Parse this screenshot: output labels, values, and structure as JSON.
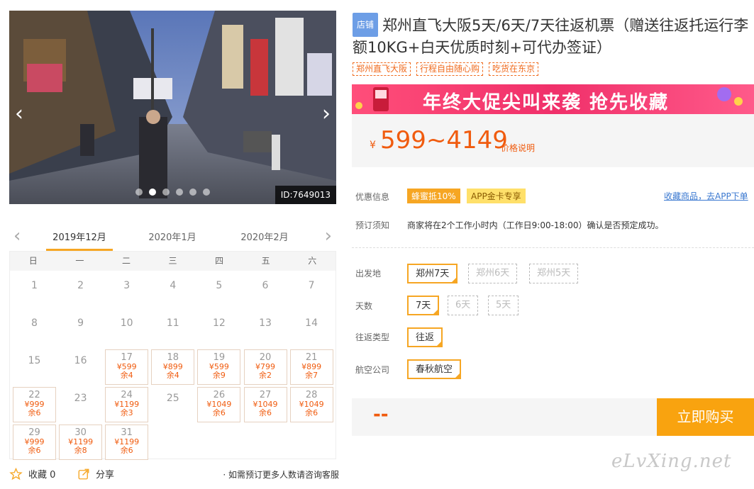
{
  "gallery": {
    "id_label": "ID:7649013",
    "dot_count": 6,
    "active_dot": 1
  },
  "calendar": {
    "months": [
      "2019年12月",
      "2020年1月",
      "2020年2月"
    ],
    "active_month": 0,
    "weekdays": [
      "日",
      "一",
      "二",
      "三",
      "四",
      "五",
      "六"
    ],
    "start_weekday": 0,
    "days": [
      {
        "d": "1"
      },
      {
        "d": "2"
      },
      {
        "d": "3"
      },
      {
        "d": "4"
      },
      {
        "d": "5"
      },
      {
        "d": "6"
      },
      {
        "d": "7"
      },
      {
        "d": "8"
      },
      {
        "d": "9"
      },
      {
        "d": "10"
      },
      {
        "d": "11"
      },
      {
        "d": "12"
      },
      {
        "d": "13"
      },
      {
        "d": "14"
      },
      {
        "d": "15"
      },
      {
        "d": "16"
      },
      {
        "d": "17",
        "p": "¥599",
        "s": "余4"
      },
      {
        "d": "18",
        "p": "¥899",
        "s": "余4"
      },
      {
        "d": "19",
        "p": "¥599",
        "s": "余9"
      },
      {
        "d": "20",
        "p": "¥799",
        "s": "余2"
      },
      {
        "d": "21",
        "p": "¥899",
        "s": "余7"
      },
      {
        "d": "22",
        "p": "¥999",
        "s": "余6"
      },
      {
        "d": "23"
      },
      {
        "d": "24",
        "p": "¥1199",
        "s": "余3"
      },
      {
        "d": "25"
      },
      {
        "d": "26",
        "p": "¥1049",
        "s": "余6"
      },
      {
        "d": "27",
        "p": "¥1049",
        "s": "余6"
      },
      {
        "d": "28",
        "p": "¥1049",
        "s": "余6"
      },
      {
        "d": "29",
        "p": "¥999",
        "s": "余6"
      },
      {
        "d": "30",
        "p": "¥1199",
        "s": "余8"
      },
      {
        "d": "31",
        "p": "¥1199",
        "s": "余6"
      }
    ]
  },
  "bottom": {
    "fav_label": "收藏 0",
    "share_label": "分享",
    "hint": "· 如需预订更多人数请咨询客服"
  },
  "product": {
    "shop_badge": "店铺",
    "title": "郑州直飞大阪5天/6天/7天往返机票（赠送往返托运行李额10KG+白天优质时刻+可代办签证）",
    "tags": [
      "郑州直飞大阪",
      "行程自由随心购",
      "吃货在东京"
    ],
    "banner_text": "年终大促尖叫来袭  抢先收藏",
    "price_symbol": "¥",
    "price": "599~4149",
    "price_explain": "价格说明"
  },
  "info": {
    "promo_label": "优惠信息",
    "promo1": "蜂蜜抵10%",
    "promo2": "APP金卡专享",
    "app_link": "收藏商品，去APP下单",
    "notice_label": "预订须知",
    "notice": "商家将在2个工作小时内（工作日9:00-18:00）确认是否预定成功。"
  },
  "options": {
    "departure_label": "出发地",
    "departure": [
      {
        "label": "郑州7天",
        "selected": true
      },
      {
        "label": "郑州6天",
        "selected": false
      },
      {
        "label": "郑州5天",
        "selected": false
      }
    ],
    "days_label": "天数",
    "days": [
      {
        "label": "7天",
        "selected": true
      },
      {
        "label": "6天",
        "selected": false
      },
      {
        "label": "5天",
        "selected": false
      }
    ],
    "trip_label": "往返类型",
    "trip": [
      {
        "label": "往返",
        "selected": true
      }
    ],
    "airline_label": "航空公司",
    "airline": [
      {
        "label": "春秋航空",
        "selected": true
      }
    ]
  },
  "buy": {
    "total": "--",
    "button": "立即购买"
  },
  "watermark": "eLvXing.net",
  "colors": {
    "accent_orange": "#f6a623",
    "price_orange": "#f05b0e",
    "buy_button": "#f9a30f",
    "shop_badge_blue": "#6d9ee6",
    "link_blue": "#3a78d0",
    "banner_red": "#f03a6c"
  }
}
